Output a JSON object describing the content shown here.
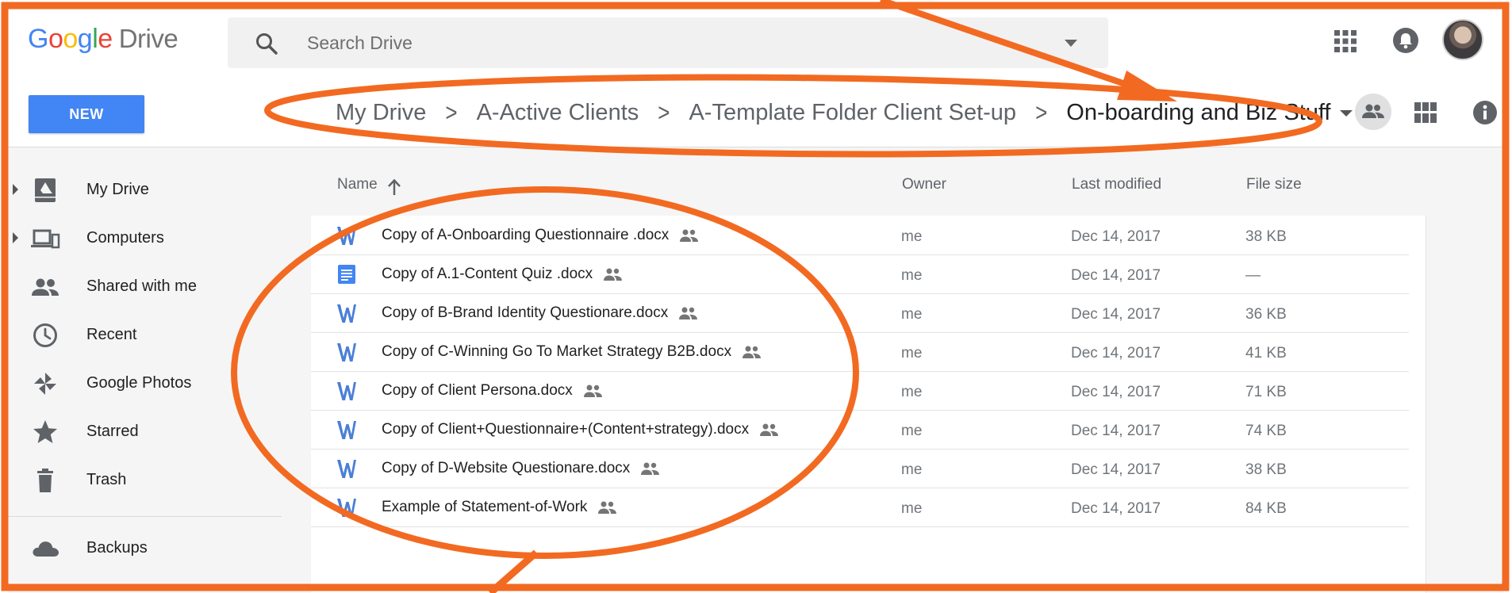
{
  "header": {
    "logo": {
      "g1": "G",
      "g2": "o",
      "g3": "o",
      "g4": "g",
      "g5": "l",
      "g6": "e",
      "product": "Drive"
    },
    "search_placeholder": "Search Drive",
    "icons": [
      "search-icon",
      "apps-grid-icon",
      "notifications-bell-icon",
      "account-avatar"
    ]
  },
  "toolbar": {
    "new_label": "NEW",
    "breadcrumb": [
      {
        "label": "My Drive"
      },
      {
        "label": "A-Active Clients"
      },
      {
        "label": "A-Template Folder Client Set-up"
      },
      {
        "label": "On-boarding and Biz Stuff"
      }
    ],
    "separator": ">"
  },
  "sidebar": {
    "items": [
      {
        "label": "My Drive",
        "icon": "my-drive-icon",
        "expandable": true
      },
      {
        "label": "Computers",
        "icon": "computers-icon",
        "expandable": true
      },
      {
        "label": "Shared with me",
        "icon": "shared-people-icon",
        "expandable": false
      },
      {
        "label": "Recent",
        "icon": "clock-icon",
        "expandable": false
      },
      {
        "label": "Google Photos",
        "icon": "pinwheel-icon",
        "expandable": false
      },
      {
        "label": "Starred",
        "icon": "star-icon",
        "expandable": false
      },
      {
        "label": "Trash",
        "icon": "trash-icon",
        "expandable": false
      },
      {
        "label": "Backups",
        "icon": "cloud-icon",
        "expandable": false
      }
    ]
  },
  "file_list": {
    "columns": {
      "name": "Name",
      "owner": "Owner",
      "modified": "Last modified",
      "size": "File size"
    },
    "rows": [
      {
        "name": "Copy of A-Onboarding Questionnaire .docx",
        "type": "word",
        "owner": "me",
        "modified": "Dec 14, 2017",
        "size": "38 KB"
      },
      {
        "name": "Copy of A.1-Content Quiz .docx",
        "type": "gdoc",
        "owner": "me",
        "modified": "Dec 14, 2017",
        "size": "—"
      },
      {
        "name": "Copy of B-Brand Identity Questionare.docx",
        "type": "word",
        "owner": "me",
        "modified": "Dec 14, 2017",
        "size": "36 KB"
      },
      {
        "name": "Copy of C-Winning Go To Market Strategy B2B.docx",
        "type": "word",
        "owner": "me",
        "modified": "Dec 14, 2017",
        "size": "41 KB"
      },
      {
        "name": "Copy of Client Persona.docx",
        "type": "word",
        "owner": "me",
        "modified": "Dec 14, 2017",
        "size": "71 KB"
      },
      {
        "name": "Copy of Client+Questionnaire+(Content+strategy).docx",
        "type": "word",
        "owner": "me",
        "modified": "Dec 14, 2017",
        "size": "74 KB"
      },
      {
        "name": "Copy of D-Website Questionare.docx",
        "type": "word",
        "owner": "me",
        "modified": "Dec 14, 2017",
        "size": "38 KB"
      },
      {
        "name": "Example of Statement-of-Work",
        "type": "word",
        "owner": "me",
        "modified": "Dec 14, 2017",
        "size": "84 KB"
      }
    ]
  },
  "colors": {
    "accent_blue": "#4285f4",
    "annotation_orange": "#f26a21",
    "word_icon_blue": "#4a7fd6",
    "gdoc_icon_blue": "#4285f4"
  }
}
